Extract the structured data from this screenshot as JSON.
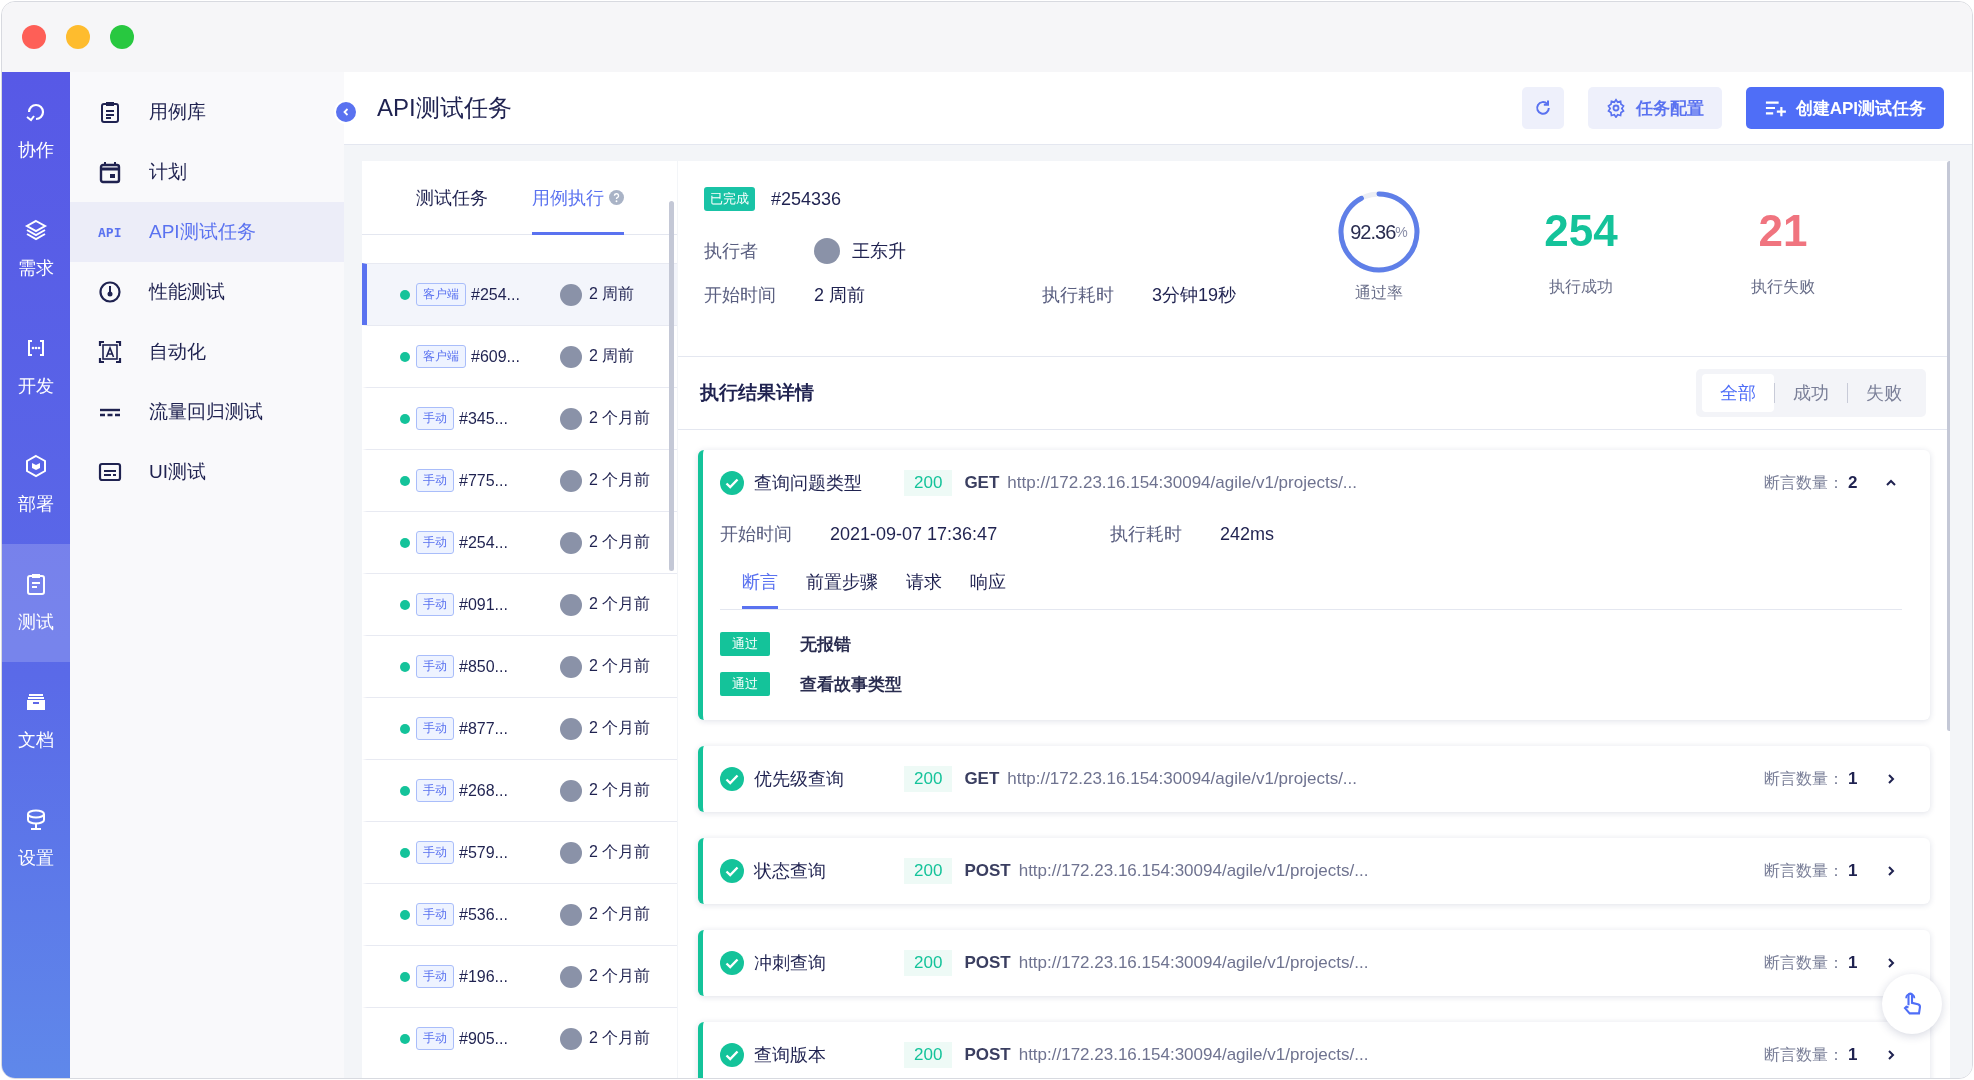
{
  "rail": [
    {
      "label": "协作",
      "selected": false
    },
    {
      "label": "需求",
      "selected": false
    },
    {
      "label": "开发",
      "selected": false
    },
    {
      "label": "部署",
      "selected": false
    },
    {
      "label": "测试",
      "selected": true
    },
    {
      "label": "文档",
      "selected": false
    },
    {
      "label": "设置",
      "selected": false
    }
  ],
  "sidebar": {
    "items": [
      {
        "label": "用例库",
        "selected": false
      },
      {
        "label": "计划",
        "selected": false
      },
      {
        "label": "API测试任务",
        "selected": true,
        "icon_text": "API"
      },
      {
        "label": "性能测试",
        "selected": false
      },
      {
        "label": "自动化",
        "selected": false
      },
      {
        "label": "流量回归测试",
        "selected": false
      },
      {
        "label": "UI测试",
        "selected": false
      }
    ]
  },
  "header": {
    "title": "API测试任务",
    "buttons": [
      {
        "kind": "refresh"
      },
      {
        "kind": "settings",
        "label": "任务配置"
      },
      {
        "kind": "create",
        "label": "创建API测试任务"
      }
    ]
  },
  "list": {
    "tabs": [
      {
        "label": "测试任务",
        "selected": false,
        "help": false
      },
      {
        "label": "用例执行",
        "selected": true,
        "help": true
      }
    ],
    "rows": [
      {
        "tag": "客户端",
        "id": "#254...",
        "time": "2 周前",
        "selected": true
      },
      {
        "tag": "客户端",
        "id": "#609...",
        "time": "2 周前",
        "selected": false
      },
      {
        "tag": "手动",
        "id": "#345...",
        "time": "2 个月前",
        "selected": false
      },
      {
        "tag": "手动",
        "id": "#775...",
        "time": "2 个月前",
        "selected": false
      },
      {
        "tag": "手动",
        "id": "#254...",
        "time": "2 个月前",
        "selected": false
      },
      {
        "tag": "手动",
        "id": "#091...",
        "time": "2 个月前",
        "selected": false
      },
      {
        "tag": "手动",
        "id": "#850...",
        "time": "2 个月前",
        "selected": false
      },
      {
        "tag": "手动",
        "id": "#877...",
        "time": "2 个月前",
        "selected": false
      },
      {
        "tag": "手动",
        "id": "#268...",
        "time": "2 个月前",
        "selected": false
      },
      {
        "tag": "手动",
        "id": "#579...",
        "time": "2 个月前",
        "selected": false
      },
      {
        "tag": "手动",
        "id": "#536...",
        "time": "2 个月前",
        "selected": false
      },
      {
        "tag": "手动",
        "id": "#196...",
        "time": "2 个月前",
        "selected": false
      },
      {
        "tag": "手动",
        "id": "#905...",
        "time": "2 个月前",
        "selected": false
      }
    ]
  },
  "summary": {
    "status": "已完成",
    "id": "#254336",
    "executor_label": "执行者",
    "executor": "王东升",
    "start_label": "开始时间",
    "start": "2 周前",
    "duration_label": "执行耗时",
    "duration": "3分钟19秒",
    "pass_rate": {
      "value": "92.36",
      "unit": "%",
      "label": "通过率",
      "level": 0.9236
    },
    "success": {
      "value": "254",
      "label": "执行成功"
    },
    "failure": {
      "value": "21",
      "label": "执行失败"
    }
  },
  "results": {
    "title": "执行结果详情",
    "filters": [
      {
        "label": "全部",
        "selected": true
      },
      {
        "label": "成功",
        "selected": false
      },
      {
        "label": "失败",
        "selected": false
      }
    ],
    "cases": [
      {
        "name": "查询问题类型",
        "code": "200",
        "method": "GET",
        "url": "http://172.23.16.154:30094/agile/v1/projects/...",
        "assert_label": "断言数量：",
        "assert_count": "2",
        "expanded": true,
        "details": {
          "start_label": "开始时间",
          "start": "2021-09-07 17:36:47",
          "duration_label": "执行耗时",
          "duration": "242ms",
          "tabs": [
            {
              "label": "断言",
              "selected": true
            },
            {
              "label": "前置步骤",
              "selected": false
            },
            {
              "label": "请求",
              "selected": false
            },
            {
              "label": "响应",
              "selected": false
            }
          ],
          "assertions": [
            {
              "result": "通过",
              "text": "无报错"
            },
            {
              "result": "通过",
              "text": "查看故事类型"
            }
          ]
        }
      },
      {
        "name": "优先级查询",
        "code": "200",
        "method": "GET",
        "url": "http://172.23.16.154:30094/agile/v1/projects/...",
        "assert_label": "断言数量：",
        "assert_count": "1",
        "expanded": false
      },
      {
        "name": "状态查询",
        "code": "200",
        "method": "POST",
        "url": "http://172.23.16.154:30094/agile/v1/projects/...",
        "assert_label": "断言数量：",
        "assert_count": "1",
        "expanded": false
      },
      {
        "name": "冲刺查询",
        "code": "200",
        "method": "POST",
        "url": "http://172.23.16.154:30094/agile/v1/projects/...",
        "assert_label": "断言数量：",
        "assert_count": "1",
        "expanded": false
      },
      {
        "name": "查询版本",
        "code": "200",
        "method": "POST",
        "url": "http://172.23.16.154:30094/agile/v1/projects/...",
        "assert_label": "断言数量：",
        "assert_count": "1",
        "expanded": false
      }
    ]
  }
}
